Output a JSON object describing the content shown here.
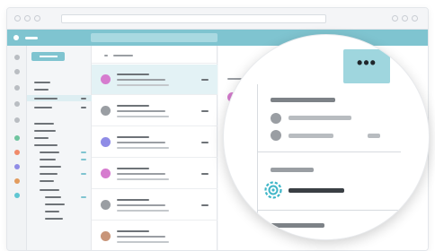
{
  "toolbar": {
    "more_label": "•••"
  },
  "icons": {
    "menu": "menu-icon",
    "more": "more-options-icon",
    "addin": "add-in-gear-icon"
  },
  "colors": {
    "accent": "#7fc4d0",
    "selected": "#e3f2f5",
    "more_button": "#9fd6de",
    "avatar_pink": "#d67ccf",
    "avatar_purple": "#8f8ce6",
    "avatar_grey": "#9a9ea3",
    "avatar_brown": "#c89579"
  }
}
